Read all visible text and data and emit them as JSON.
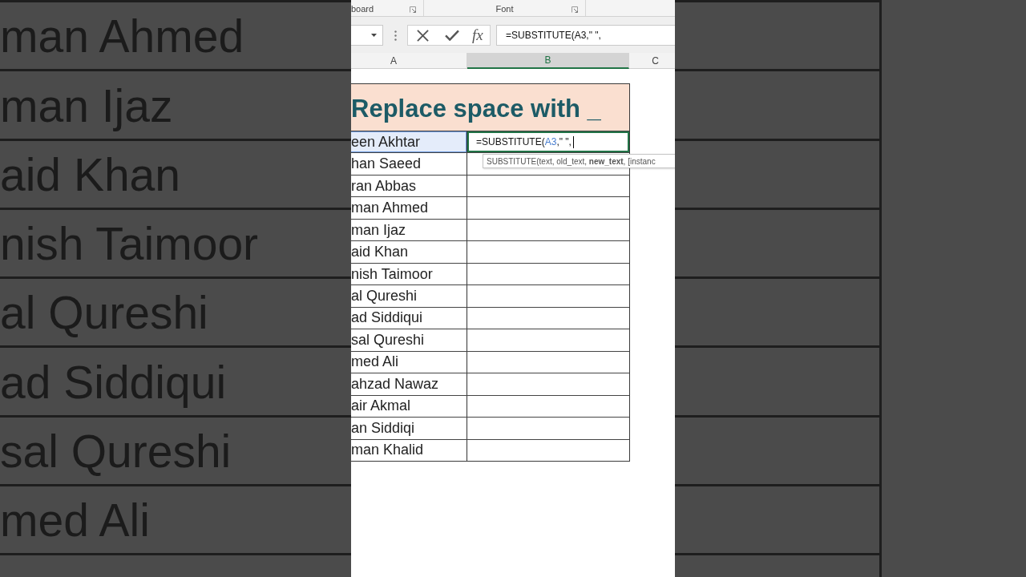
{
  "backdrop": {
    "names": [
      "man Ahmed",
      "man Ijaz",
      "aid Khan",
      "nish Taimoor",
      "al Qureshi",
      "ad Siddiqui",
      "sal Qureshi",
      "med Ali"
    ]
  },
  "ribbon": {
    "groups": [
      {
        "label": "board"
      },
      {
        "label": "Font"
      }
    ]
  },
  "formula_bar": {
    "function_button": "fx",
    "value": "=SUBSTITUTE(A3,\" \","
  },
  "column_headers": [
    {
      "label": "A",
      "selected": false
    },
    {
      "label": "B",
      "selected": true
    },
    {
      "label": "C",
      "selected": false
    }
  ],
  "sheet": {
    "title": "Replace space with _",
    "rows": [
      {
        "name": "een Akhtar",
        "referenced": true,
        "active": true,
        "value_parts": [
          {
            "text": "=SUBSTITUTE(",
            "kind": "text"
          },
          {
            "text": "A3",
            "kind": "reference"
          },
          {
            "text": ",\" \",",
            "kind": "text"
          }
        ]
      },
      {
        "name": "han Saeed",
        "referenced": false,
        "active": false
      },
      {
        "name": "ran Abbas",
        "referenced": false,
        "active": false
      },
      {
        "name": "man Ahmed",
        "referenced": false,
        "active": false
      },
      {
        "name": "man Ijaz",
        "referenced": false,
        "active": false
      },
      {
        "name": "aid Khan",
        "referenced": false,
        "active": false
      },
      {
        "name": "nish Taimoor",
        "referenced": false,
        "active": false
      },
      {
        "name": "al Qureshi",
        "referenced": false,
        "active": false
      },
      {
        "name": "ad Siddiqui",
        "referenced": false,
        "active": false
      },
      {
        "name": "sal Qureshi",
        "referenced": false,
        "active": false
      },
      {
        "name": "med Ali",
        "referenced": false,
        "active": false
      },
      {
        "name": "ahzad Nawaz",
        "referenced": false,
        "active": false
      },
      {
        "name": "air Akmal",
        "referenced": false,
        "active": false
      },
      {
        "name": "an Siddiqi",
        "referenced": false,
        "active": false
      },
      {
        "name": "man Khalid",
        "referenced": false,
        "active": false
      }
    ]
  },
  "tooltip": "SUBSTITUTE(text, old_text, **new_text**, [instanc"
}
